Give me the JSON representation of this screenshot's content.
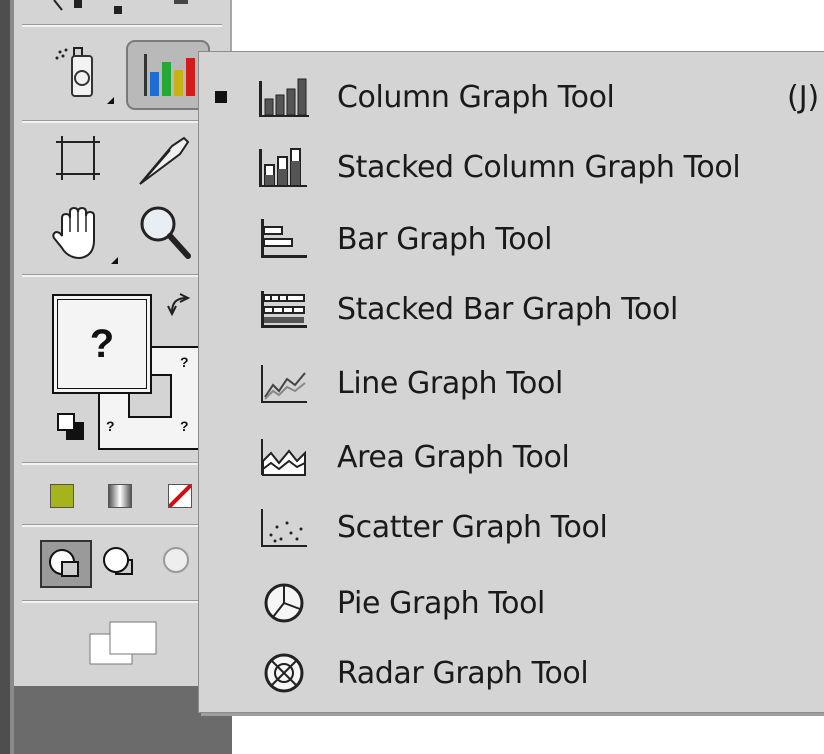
{
  "flyout": {
    "items": [
      {
        "label": "Column Graph Tool",
        "shortcut": "(J)",
        "selected": true,
        "icon": "column-graph-icon"
      },
      {
        "label": "Stacked Column Graph Tool",
        "icon": "stacked-column-graph-icon"
      },
      {
        "label": "Bar Graph Tool",
        "icon": "bar-graph-icon"
      },
      {
        "label": "Stacked Bar Graph Tool",
        "icon": "stacked-bar-graph-icon"
      },
      {
        "label": "Line Graph Tool",
        "icon": "line-graph-icon"
      },
      {
        "label": "Area Graph Tool",
        "icon": "area-graph-icon"
      },
      {
        "label": "Scatter Graph Tool",
        "icon": "scatter-graph-icon"
      },
      {
        "label": "Pie Graph Tool",
        "icon": "pie-graph-icon"
      },
      {
        "label": "Radar Graph Tool",
        "icon": "radar-graph-icon"
      }
    ]
  },
  "toolbox": {
    "fill_label": "?",
    "stroke_label": "?",
    "swatch_colors": {
      "color": "#a7b31a",
      "gradient": "#8a8a8a",
      "none": "#d01010"
    }
  }
}
